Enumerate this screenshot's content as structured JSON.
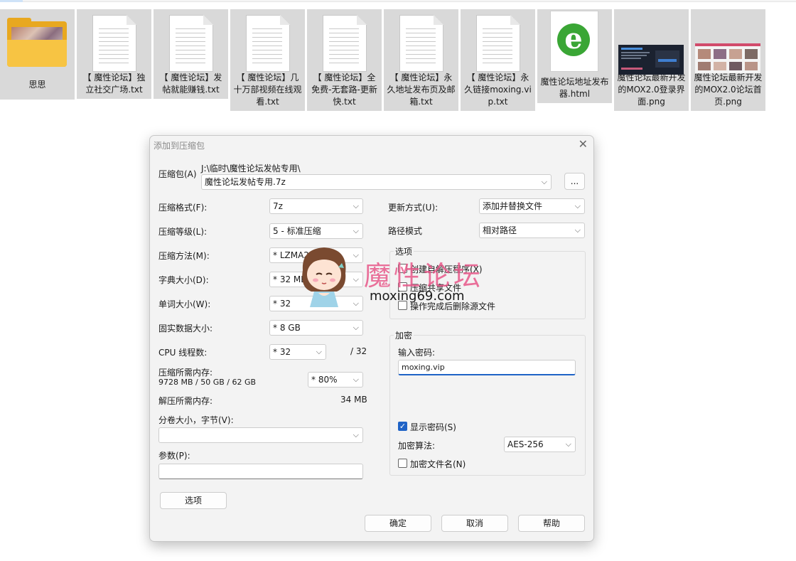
{
  "files": [
    {
      "name": "思思",
      "icon": "folder-icon"
    },
    {
      "name": "【 魔性论坛】独立社交广场.txt",
      "icon": "text-file-icon"
    },
    {
      "name": "【 魔性论坛】发帖就能赚钱.txt",
      "icon": "text-file-icon"
    },
    {
      "name": "【 魔性论坛】几十万部视频在线观看.txt",
      "icon": "text-file-icon"
    },
    {
      "name": "【 魔性论坛】全免费-无套路-更新快.txt",
      "icon": "text-file-icon"
    },
    {
      "name": "【 魔性论坛】永久地址发布页及邮箱.txt",
      "icon": "text-file-icon"
    },
    {
      "name": "【 魔性论坛】永久链接moxing.vip.txt",
      "icon": "text-file-icon"
    },
    {
      "name": "魔性论坛地址发布器.html",
      "icon": "ie-html-icon"
    },
    {
      "name": "魔性论坛最新开发的MOX2.0登录界面.png",
      "icon": "image-file-icon"
    },
    {
      "name": "魔性论坛最新开发的MOX2.0论坛首页.png",
      "icon": "image-file-icon"
    }
  ],
  "dialog": {
    "title": "添加到压缩包",
    "close": "✕",
    "archive_label": "压缩包(A)",
    "archive_path": "J:\\临时\\魔性论坛发帖专用\\",
    "archive_name": "魔性论坛发帖专用.7z",
    "browse_label": "...",
    "left": {
      "format_label": "压缩格式(F):",
      "format_value": "7z",
      "level_label": "压缩等级(L):",
      "level_value": "5 - 标准压缩",
      "method_label": "压缩方法(M):",
      "method_value": "*  LZMA2",
      "dict_label": "字典大小(D):",
      "dict_value": "*  32 MB",
      "word_label": "单词大小(W):",
      "word_value": "*  32",
      "solid_label": "固实数据大小:",
      "solid_value": "*  8 GB",
      "cpu_label": "CPU 线程数:",
      "cpu_value": "*  32",
      "cpu_total": "/ 32",
      "mem_label": "压缩所需内存:",
      "mem_value": "9728 MB / 50 GB / 62 GB",
      "mem_percent": "*  80%",
      "decomp_label": "解压所需内存:",
      "decomp_value": "34 MB",
      "split_label": "分卷大小，字节(V):",
      "split_value": "",
      "params_label": "参数(P):",
      "params_value": "",
      "options_button": "选项"
    },
    "right": {
      "update_label": "更新方式(U):",
      "update_value": "添加并替换文件",
      "path_label": "路径模式",
      "path_value": "相对路径",
      "options_group": "选项",
      "opt_sfx": "创建自解压程序(X)",
      "opt_shared": "压缩共享文件",
      "opt_delete": "操作完成后删除源文件",
      "encrypt_group": "加密",
      "password_label": "输入密码:",
      "password_value": "moxing.vip",
      "show_password": "显示密码(S)",
      "show_password_checked": true,
      "algo_label": "加密算法:",
      "algo_value": "AES-256",
      "encrypt_names": "加密文件名(N)"
    },
    "ok_button": "确定",
    "cancel_button": "取消",
    "help_button": "帮助"
  },
  "watermark": {
    "text": "魔性论坛",
    "url": "moxing69.com"
  },
  "arrow_glyph": "⌵",
  "checkmark_glyph": "✓"
}
